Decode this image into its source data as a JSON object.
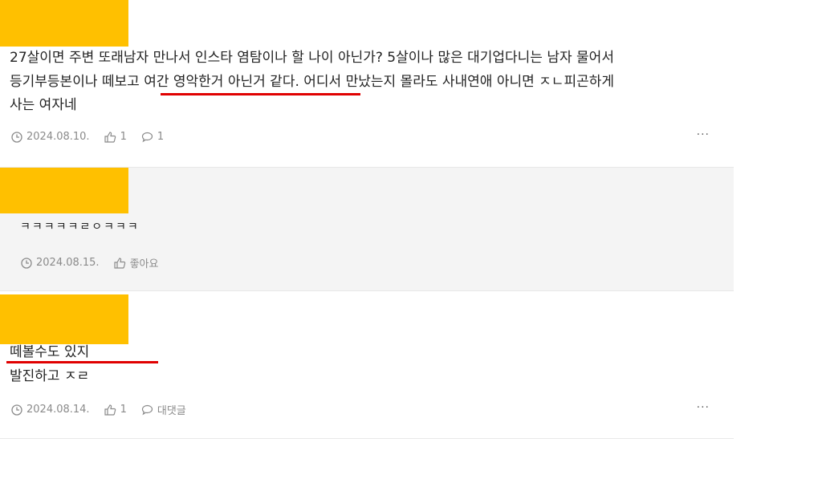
{
  "comments": [
    {
      "lines": [
        "27살이면 주변 또래남자 만나서 인스타 염탐이나 할 나이 아닌가? 5살이나 많은 대기업다니는 남자 물어서",
        "등기부등본이나 떼보고 여간 영악한거 아닌거 같다. 어디서 만났는지 몰라도 사내연애 아니면 ㅈㄴ피곤하게",
        "사는 여자네"
      ],
      "date": "2024.08.10.",
      "likes": "1",
      "replies": "1",
      "more": "···"
    },
    {
      "lines": [
        "ㅋㅋㅋㅋㅋㄹㅇㅋㅋㅋ"
      ],
      "date": "2024.08.15.",
      "likes": "좋아요"
    },
    {
      "lines": [
        "떼볼수도 있지",
        "발진하고 ㅈㄹ"
      ],
      "date": "2024.08.14.",
      "likes": "1",
      "replies": "대댓글",
      "more": "···"
    }
  ],
  "colors": {
    "redaction": "#ffc000",
    "underline": "#e00000",
    "meta": "#8a8a8a"
  },
  "icons": [
    "clock-icon",
    "thumbs-up-icon",
    "speech-bubble-icon",
    "more-icon"
  ]
}
